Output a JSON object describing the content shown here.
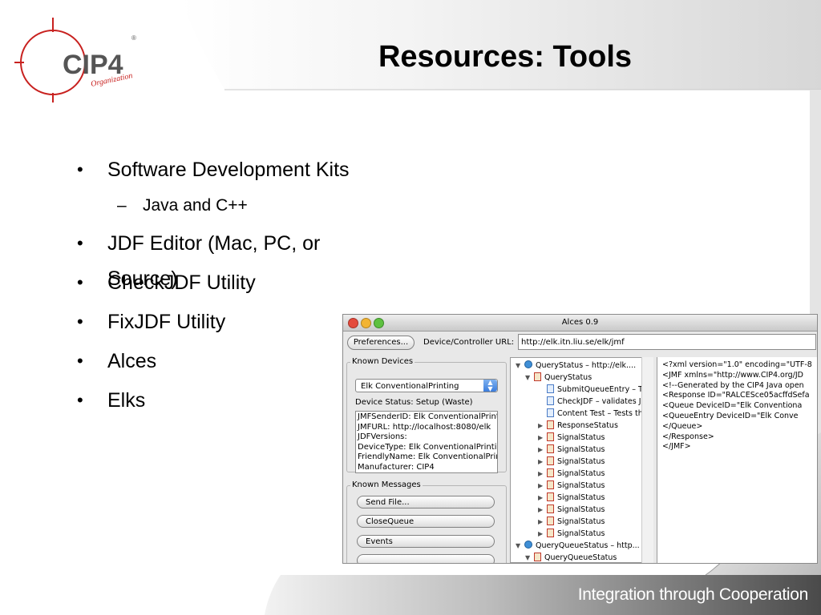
{
  "slide": {
    "title": "Resources: Tools",
    "footer": "Integration through Cooperation",
    "logo_text": "CIP4",
    "logo_sub": "Organization",
    "logo_mark": "®"
  },
  "bullets": [
    {
      "text": "Software Development Kits",
      "sub": [
        "Java and C++"
      ]
    },
    {
      "text": "JDF Editor (Mac, PC, or Source)"
    },
    {
      "text": "CheckJDF Utility"
    },
    {
      "text": "FixJDF Utility"
    },
    {
      "text": "Alces"
    },
    {
      "text": "Elks"
    }
  ],
  "bullet_symbol": "•",
  "sub_bullet_symbol": "–",
  "app": {
    "title": "Alces 0.9",
    "preferences_label": "Preferences...",
    "url_label": "Device/Controller URL:",
    "url_value": "http://elk.itn.liu.se/elk/jmf",
    "known_devices_label": "Known Devices",
    "device_selected": "Elk ConventionalPrinting",
    "device_status": "Device Status:  Setup (Waste)",
    "device_info": [
      "JMFSenderID: Elk ConventionalPrint",
      "JMFURL: http://localhost:8080/elk",
      "JDFVersions:",
      "DeviceType: Elk ConventionalPrinti",
      "FriendlyName: Elk ConventionalPrir",
      "Manufacturer: CIP4"
    ],
    "known_messages_label": "Known Messages",
    "message_buttons": [
      "Send File...",
      "CloseQueue",
      "Events"
    ],
    "tree": [
      {
        "depth": 0,
        "icon": "globe",
        "expanded": true,
        "text": "QueryStatus  – http://elk...."
      },
      {
        "depth": 1,
        "icon": "doc",
        "expanded": true,
        "text": "QueryStatus"
      },
      {
        "depth": 2,
        "icon": "check",
        "expanded": null,
        "text": "SubmitQueueEntry – Te"
      },
      {
        "depth": 2,
        "icon": "check",
        "expanded": null,
        "text": "CheckJDF – validates JI"
      },
      {
        "depth": 2,
        "icon": "check",
        "expanded": null,
        "text": "Content Test – Tests th"
      },
      {
        "depth": 2,
        "icon": "doc",
        "expanded": false,
        "text": "ResponseStatus"
      },
      {
        "depth": 2,
        "icon": "doc",
        "expanded": false,
        "text": "SignalStatus"
      },
      {
        "depth": 2,
        "icon": "doc",
        "expanded": false,
        "text": "SignalStatus"
      },
      {
        "depth": 2,
        "icon": "doc",
        "expanded": false,
        "text": "SignalStatus"
      },
      {
        "depth": 2,
        "icon": "doc",
        "expanded": false,
        "text": "SignalStatus"
      },
      {
        "depth": 2,
        "icon": "doc",
        "expanded": false,
        "text": "SignalStatus"
      },
      {
        "depth": 2,
        "icon": "doc",
        "expanded": false,
        "text": "SignalStatus"
      },
      {
        "depth": 2,
        "icon": "doc",
        "expanded": false,
        "text": "SignalStatus"
      },
      {
        "depth": 2,
        "icon": "doc",
        "expanded": false,
        "text": "SignalStatus"
      },
      {
        "depth": 2,
        "icon": "doc",
        "expanded": false,
        "text": "SignalStatus"
      },
      {
        "depth": 0,
        "icon": "globe",
        "expanded": true,
        "text": "QueryQueueStatus  – http..."
      },
      {
        "depth": 1,
        "icon": "doc",
        "expanded": true,
        "text": "QueryQueueStatus"
      }
    ],
    "xml_lines": [
      "<?xml version=\"1.0\" encoding=\"UTF-8",
      "<JMF xmlns=\"http://www.CIP4.org/JD",
      "  <!--Generated by the CIP4 Java open",
      "  <Response ID=\"RALCESce05acffdSefa",
      "    <Queue DeviceID=\"Elk Conventiona",
      "      <QueueEntry DeviceID=\"Elk Conve",
      "    </Queue>",
      "  </Response>",
      "</JMF>"
    ],
    "colors": {
      "close": "#e44b3c",
      "minimize": "#f2b434",
      "zoom": "#5ec140",
      "accent": "#3b7ddd"
    }
  },
  "colors": {
    "logo_red": "#c8211f",
    "logo_gray": "#555555",
    "footer_band": "#555555"
  }
}
